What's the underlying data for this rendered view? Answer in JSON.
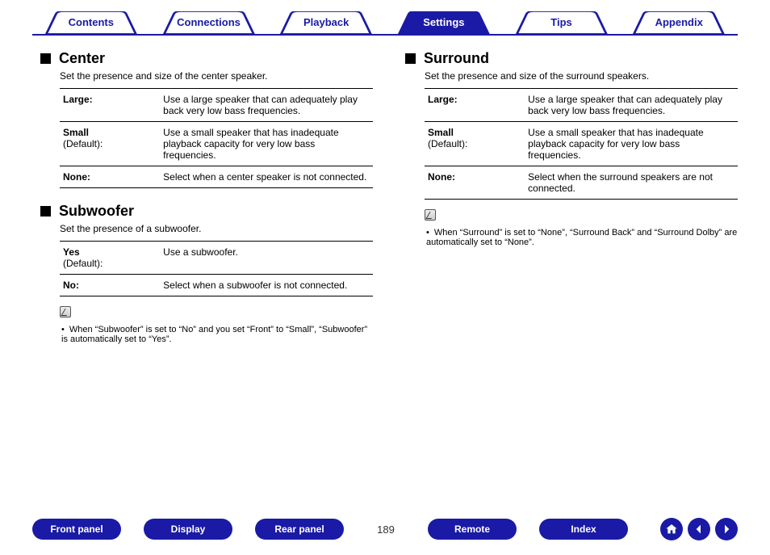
{
  "tabs": {
    "items": [
      {
        "label": "Contents",
        "active": false
      },
      {
        "label": "Connections",
        "active": false
      },
      {
        "label": "Playback",
        "active": false
      },
      {
        "label": "Settings",
        "active": true
      },
      {
        "label": "Tips",
        "active": false
      },
      {
        "label": "Appendix",
        "active": false
      }
    ]
  },
  "left": {
    "center": {
      "heading": "Center",
      "subtitle": "Set the presence and size of the center speaker.",
      "rows": [
        {
          "k1": "Large:",
          "k2": "",
          "v": "Use a large speaker that can adequately play back very low bass frequencies."
        },
        {
          "k1": "Small",
          "k2": "(Default):",
          "v": "Use a small speaker that has inadequate playback capacity for very low bass frequencies."
        },
        {
          "k1": "None:",
          "k2": "",
          "v": "Select when a center speaker is not connected."
        }
      ]
    },
    "subwoofer": {
      "heading": "Subwoofer",
      "subtitle": "Set the presence of a subwoofer.",
      "rows": [
        {
          "k1": "Yes",
          "k2": "(Default):",
          "v": "Use a subwoofer."
        },
        {
          "k1": "No:",
          "k2": "",
          "v": "Select when a subwoofer is not connected."
        }
      ],
      "note": "When “Subwoofer” is set to “No” and you set “Front” to “Small”, “Subwoofer” is automatically set to “Yes”."
    }
  },
  "right": {
    "surround": {
      "heading": "Surround",
      "subtitle": "Set the presence and size of the surround speakers.",
      "rows": [
        {
          "k1": "Large:",
          "k2": "",
          "v": "Use a large speaker that can adequately play back very low bass frequencies."
        },
        {
          "k1": "Small",
          "k2": "(Default):",
          "v": "Use a small speaker that has inadequate playback capacity for very low bass frequencies."
        },
        {
          "k1": "None:",
          "k2": "",
          "v": "Select when the surround speakers are not connected."
        }
      ],
      "note": "When “Surround” is set to “None”, “Surround Back” and “Surround Dolby” are automatically set to “None”."
    }
  },
  "bottom": {
    "buttons": [
      "Front panel",
      "Display",
      "Rear panel"
    ],
    "page": "189",
    "buttons2": [
      "Remote",
      "Index"
    ]
  }
}
